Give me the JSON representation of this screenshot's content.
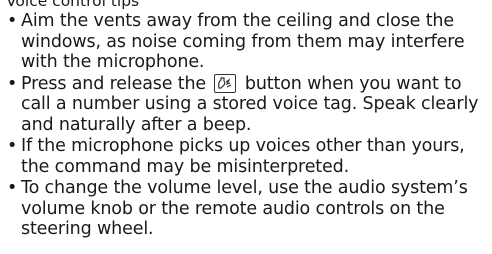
{
  "section": {
    "heading": "Voice control tips",
    "tips": [
      {
        "text": "Aim the vents away from the ceiling and close the windows, as noise coming from them may interfere with the microphone."
      },
      {
        "before": "Press and release the ",
        "icon": "talk-button-icon",
        "after": " button when you want to call a number using a stored voice tag. Speak clearly and naturally after a beep."
      },
      {
        "text": "If the microphone picks up voices other than yours, the command may be misinterpreted."
      },
      {
        "text": "To change the volume level, use the audio system’s volume knob or the remote audio controls on the steering wheel."
      }
    ]
  }
}
